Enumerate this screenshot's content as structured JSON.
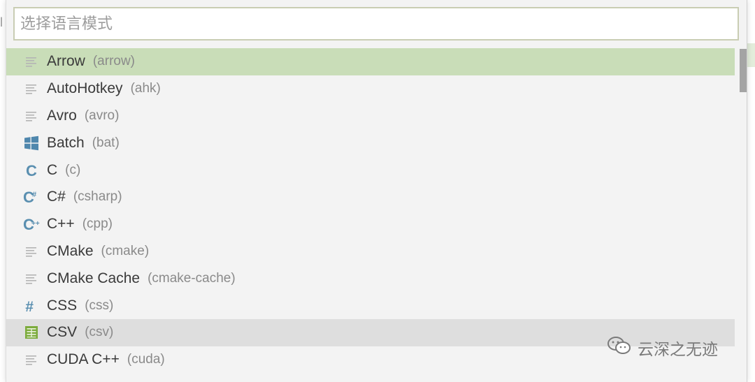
{
  "search": {
    "placeholder": "选择语言模式"
  },
  "languages": [
    {
      "name": "Arrow",
      "alias": "(arrow)",
      "icon": "lines-icon",
      "state": "selected"
    },
    {
      "name": "AutoHotkey",
      "alias": "(ahk)",
      "icon": "lines-icon",
      "state": ""
    },
    {
      "name": "Avro",
      "alias": "(avro)",
      "icon": "lines-icon",
      "state": ""
    },
    {
      "name": "Batch",
      "alias": "(bat)",
      "icon": "windows-icon",
      "state": ""
    },
    {
      "name": "C",
      "alias": "(c)",
      "icon": "c-icon",
      "state": ""
    },
    {
      "name": "C#",
      "alias": "(csharp)",
      "icon": "csharp-icon",
      "state": ""
    },
    {
      "name": "C++",
      "alias": "(cpp)",
      "icon": "cpp-icon",
      "state": ""
    },
    {
      "name": "CMake",
      "alias": "(cmake)",
      "icon": "lines-icon",
      "state": ""
    },
    {
      "name": "CMake Cache",
      "alias": "(cmake-cache)",
      "icon": "lines-icon",
      "state": ""
    },
    {
      "name": "CSS",
      "alias": "(css)",
      "icon": "hash-icon",
      "state": ""
    },
    {
      "name": "CSV",
      "alias": "(csv)",
      "icon": "table-icon",
      "state": "hover"
    },
    {
      "name": "CUDA C++",
      "alias": "(cuda)",
      "icon": "lines-icon",
      "state": ""
    }
  ],
  "watermark": {
    "text": "云深之无迹"
  },
  "colors": {
    "selected": "#c9ddb8",
    "hover": "#dedede",
    "icon_blue": "#5a8fb0",
    "icon_green": "#7cab3c"
  }
}
